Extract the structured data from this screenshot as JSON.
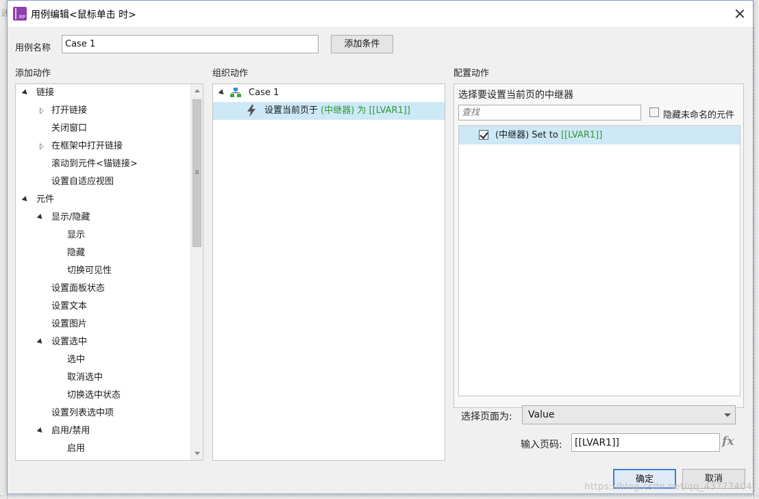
{
  "window": {
    "title": "用例编辑<鼠标单击 时>",
    "app_icon_text": "RP"
  },
  "background": {
    "edge_char": "迷"
  },
  "case_name": {
    "label": "用例名称",
    "value": "Case 1",
    "add_condition_button": "添加条件"
  },
  "add_actions": {
    "header": "添加动作",
    "items": [
      {
        "label": "链接",
        "level": 0,
        "expander": "open"
      },
      {
        "label": "打开链接",
        "level": 1,
        "expander": "closed"
      },
      {
        "label": "关闭窗口",
        "level": 1,
        "expander": "none"
      },
      {
        "label": "在框架中打开链接",
        "level": 1,
        "expander": "closed"
      },
      {
        "label": "滚动到元件<锚链接>",
        "level": 1,
        "expander": "none"
      },
      {
        "label": "设置自适应视图",
        "level": 1,
        "expander": "none"
      },
      {
        "label": "元件",
        "level": 0,
        "expander": "open"
      },
      {
        "label": "显示/隐藏",
        "level": 1,
        "expander": "open"
      },
      {
        "label": "显示",
        "level": 2,
        "expander": "none"
      },
      {
        "label": "隐藏",
        "level": 2,
        "expander": "none"
      },
      {
        "label": "切换可见性",
        "level": 2,
        "expander": "none"
      },
      {
        "label": "设置面板状态",
        "level": 1,
        "expander": "none"
      },
      {
        "label": "设置文本",
        "level": 1,
        "expander": "none"
      },
      {
        "label": "设置图片",
        "level": 1,
        "expander": "none"
      },
      {
        "label": "设置选中",
        "level": 1,
        "expander": "open"
      },
      {
        "label": "选中",
        "level": 2,
        "expander": "none"
      },
      {
        "label": "取消选中",
        "level": 2,
        "expander": "none"
      },
      {
        "label": "切换选中状态",
        "level": 2,
        "expander": "none"
      },
      {
        "label": "设置列表选中项",
        "level": 1,
        "expander": "none"
      },
      {
        "label": "启用/禁用",
        "level": 1,
        "expander": "open"
      },
      {
        "label": "启用",
        "level": 2,
        "expander": "none"
      }
    ]
  },
  "organize_actions": {
    "header": "组织动作",
    "case_label": "Case 1",
    "action": {
      "prefix": "设置当前页于 ",
      "target": "(中继器)",
      "middle": " 为 ",
      "value": "[[LVAR1]]"
    }
  },
  "configure_action": {
    "header": "配置动作",
    "subheader": "选择要设置当前页的中继器",
    "search_placeholder": "查找",
    "hide_unnamed_label": "隐藏未命名的元件",
    "hide_unnamed_checked": false,
    "repeater_row": {
      "checked": true,
      "name": "(中继器) Set to ",
      "value": "[[LVAR1]]"
    },
    "select_page_label": "选择页面为:",
    "select_page_value": "Value",
    "page_number_label": "输入页码:",
    "page_number_value": "[[LVAR1]]",
    "fx_label": "fx"
  },
  "footer": {
    "ok_button": "确定",
    "cancel_button": "取消",
    "watermark": "https://blog.csdn.net/qq_43777404"
  },
  "colors": {
    "accent_green": "#2f9a2f",
    "selection": "#cde8f6",
    "primary_button_border": "#3c7fd4"
  }
}
